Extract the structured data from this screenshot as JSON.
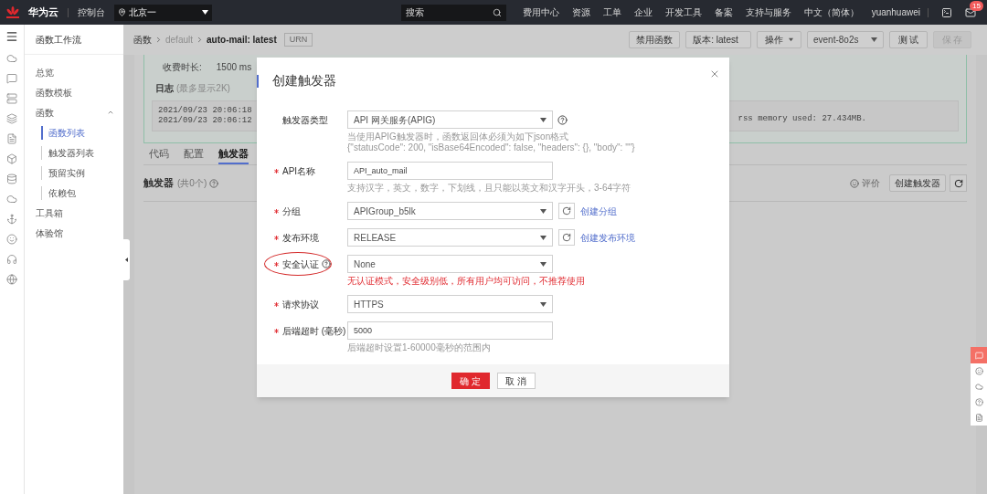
{
  "topbar": {
    "brand": "华为云",
    "console": "控制台",
    "region": "北京一",
    "search_placeholder": "搜索",
    "links": [
      "费用中心",
      "资源",
      "工单",
      "企业",
      "开发工具",
      "备案",
      "支持与服务",
      "中文（简体）"
    ],
    "user": "yuanhuawei",
    "badge": "15"
  },
  "sidebar": {
    "title": "函数工作流",
    "items": [
      {
        "label": "总览",
        "selected": false
      },
      {
        "label": "函数模板",
        "selected": false
      },
      {
        "label": "函数",
        "selected": false,
        "expanded": true,
        "children": [
          {
            "label": "函数列表",
            "selected": true
          },
          {
            "label": "触发器列表",
            "selected": false
          },
          {
            "label": "预留实例",
            "selected": false
          },
          {
            "label": "依赖包",
            "selected": false
          }
        ]
      },
      {
        "label": "工具箱",
        "selected": false
      },
      {
        "label": "体验馆",
        "selected": false
      }
    ]
  },
  "breadcrumb": [
    "函数",
    "default",
    "auto-mail: latest"
  ],
  "urn_button": "URN",
  "toolbar": {
    "disable": "禁用函数",
    "version": "版本: latest",
    "actions": "操作",
    "event": "event-8o2s",
    "test": "测 试",
    "save": {
      "label": "保 存",
      "disabled": true
    }
  },
  "log_card": {
    "duration_label": "收费时长:",
    "duration": "1500 ms",
    "log_title": "日志",
    "log_hint": "(最多显示2K)",
    "lines": [
      "2021/09/23 20:06:18",
      "2021/09/23 20:06:12"
    ],
    "tail": "rss memory used: 27.434MB."
  },
  "tabs": [
    {
      "label": "代码",
      "selected": false
    },
    {
      "label": "配置",
      "selected": false
    },
    {
      "label": "触发器",
      "selected": true
    }
  ],
  "triggers": {
    "title": "触发器",
    "count": "(共0个)",
    "rate": "评价",
    "create": "创建触发器"
  },
  "dialog": {
    "title": "创建触发器",
    "fields": [
      {
        "label": "触发器类型",
        "required": false,
        "kind": "select",
        "value": "API 网关服务(APIG)",
        "help_icon": true,
        "hints": [
          "当使用APIG触发器时，函数返回体必须为如下json格式",
          "{\"statusCode\": 200, \"isBase64Encoded\": false, \"headers\": {}, \"body\": \"\"}"
        ]
      },
      {
        "label": "API名称",
        "required": true,
        "kind": "input",
        "value": "API_auto_mail",
        "hints": [
          "支持汉字，英文，数字，下划线，且只能以英文和汉字开头，3-64字符"
        ]
      },
      {
        "label": "分组",
        "required": true,
        "kind": "select",
        "value": "APIGroup_b5lk",
        "link": "创建分组"
      },
      {
        "label": "发布环境",
        "required": true,
        "kind": "select",
        "value": "RELEASE",
        "link": "创建发布环境"
      },
      {
        "label": "安全认证",
        "required": true,
        "kind": "select",
        "value": "None",
        "label_help": true,
        "highlighted": true,
        "warnings": [
          "无认证模式，安全级别低，所有用户均可访问，不推荐使用"
        ]
      },
      {
        "label": "请求协议",
        "required": true,
        "kind": "select",
        "value": "HTTPS"
      },
      {
        "label": "后端超时 (毫秒)",
        "required": true,
        "kind": "input",
        "value": "5000",
        "hints": [
          "后端超时设置1-60000毫秒的范围内"
        ]
      }
    ],
    "confirm": "确 定",
    "cancel": "取 消"
  }
}
